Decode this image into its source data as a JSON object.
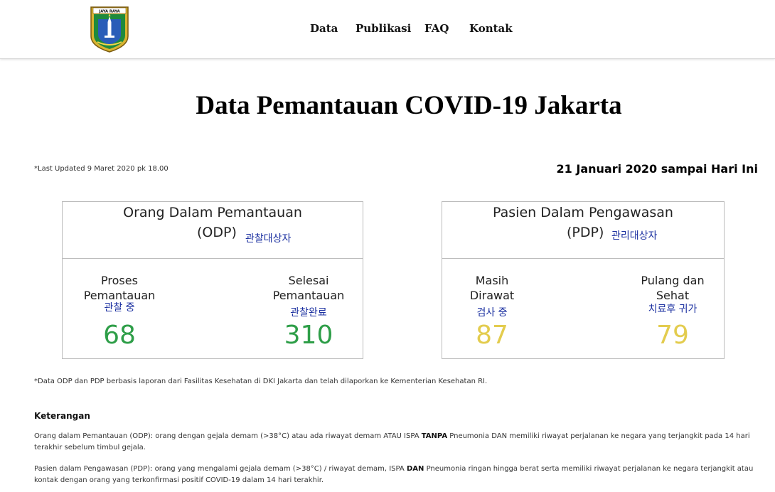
{
  "nav": {
    "logo_text": "JAYA RAYA",
    "items": [
      "Data",
      "Publikasi",
      "FAQ",
      "Kontak"
    ]
  },
  "page_title": "Data Pemantauan COVID-19 Jakarta",
  "last_updated": "*Last Updated 9 Maret 2020 pk 18.00",
  "date_range": "21 Januari 2020 sampai Hari Ini",
  "odp": {
    "title": "Orang Dalam Pemantauan",
    "abbr": "(ODP)",
    "abbr_kr": "관찰대상자",
    "stats": [
      {
        "label_1": "Proses",
        "label_2": "Pemantauan",
        "kr": "관찰 중",
        "value": "68"
      },
      {
        "label_1": "Selesai",
        "label_2": "Pemantauan",
        "kr": "관찰완료",
        "value": "310"
      }
    ]
  },
  "pdp": {
    "title": "Pasien Dalam Pengawasan",
    "abbr": "(PDP)",
    "abbr_kr": "관리대상자",
    "stats": [
      {
        "label_1": "Masih",
        "label_2": "Dirawat",
        "kr": "검사 중",
        "value": "87"
      },
      {
        "label_1": "Pulang dan",
        "label_2": "Sehat",
        "kr": "치료후 귀가",
        "value": "79"
      }
    ]
  },
  "data_note": "*Data ODP dan PDP berbasis laporan dari Fasilitas Kesehatan di DKI Jakarta dan telah dilaporkan ke Kementerian Kesehatan RI.",
  "keterangan": {
    "title": "Keterangan",
    "odp_pre": "Orang dalam Pemantauan (ODP): orang dengan gejala demam (>38°C) atau ada riwayat demam ATAU ISPA",
    "odp_bold": "TANPA",
    "odp_post": "Pneumonia DAN memiliki riwayat perjalanan ke negara yang terjangkit pada 14 hari terakhir sebelum timbul gejala.",
    "pdp_pre": "Pasien dalam Pengawasan (PDP): orang yang mengalami gejala demam (>38°C) / riwayat demam, ISPA",
    "pdp_bold": "DAN",
    "pdp_post": "Pneumonia ringan hingga berat serta memiliki riwayat perjalanan ke negara terjangkit atau kontak dengan orang yang terkonfirmasi positif COVID-19 dalam 14 hari terakhir."
  },
  "colors": {
    "odp_value": "#2e9e48",
    "pdp_value": "#e3cc4e",
    "korean_text": "#1a2fa0"
  }
}
